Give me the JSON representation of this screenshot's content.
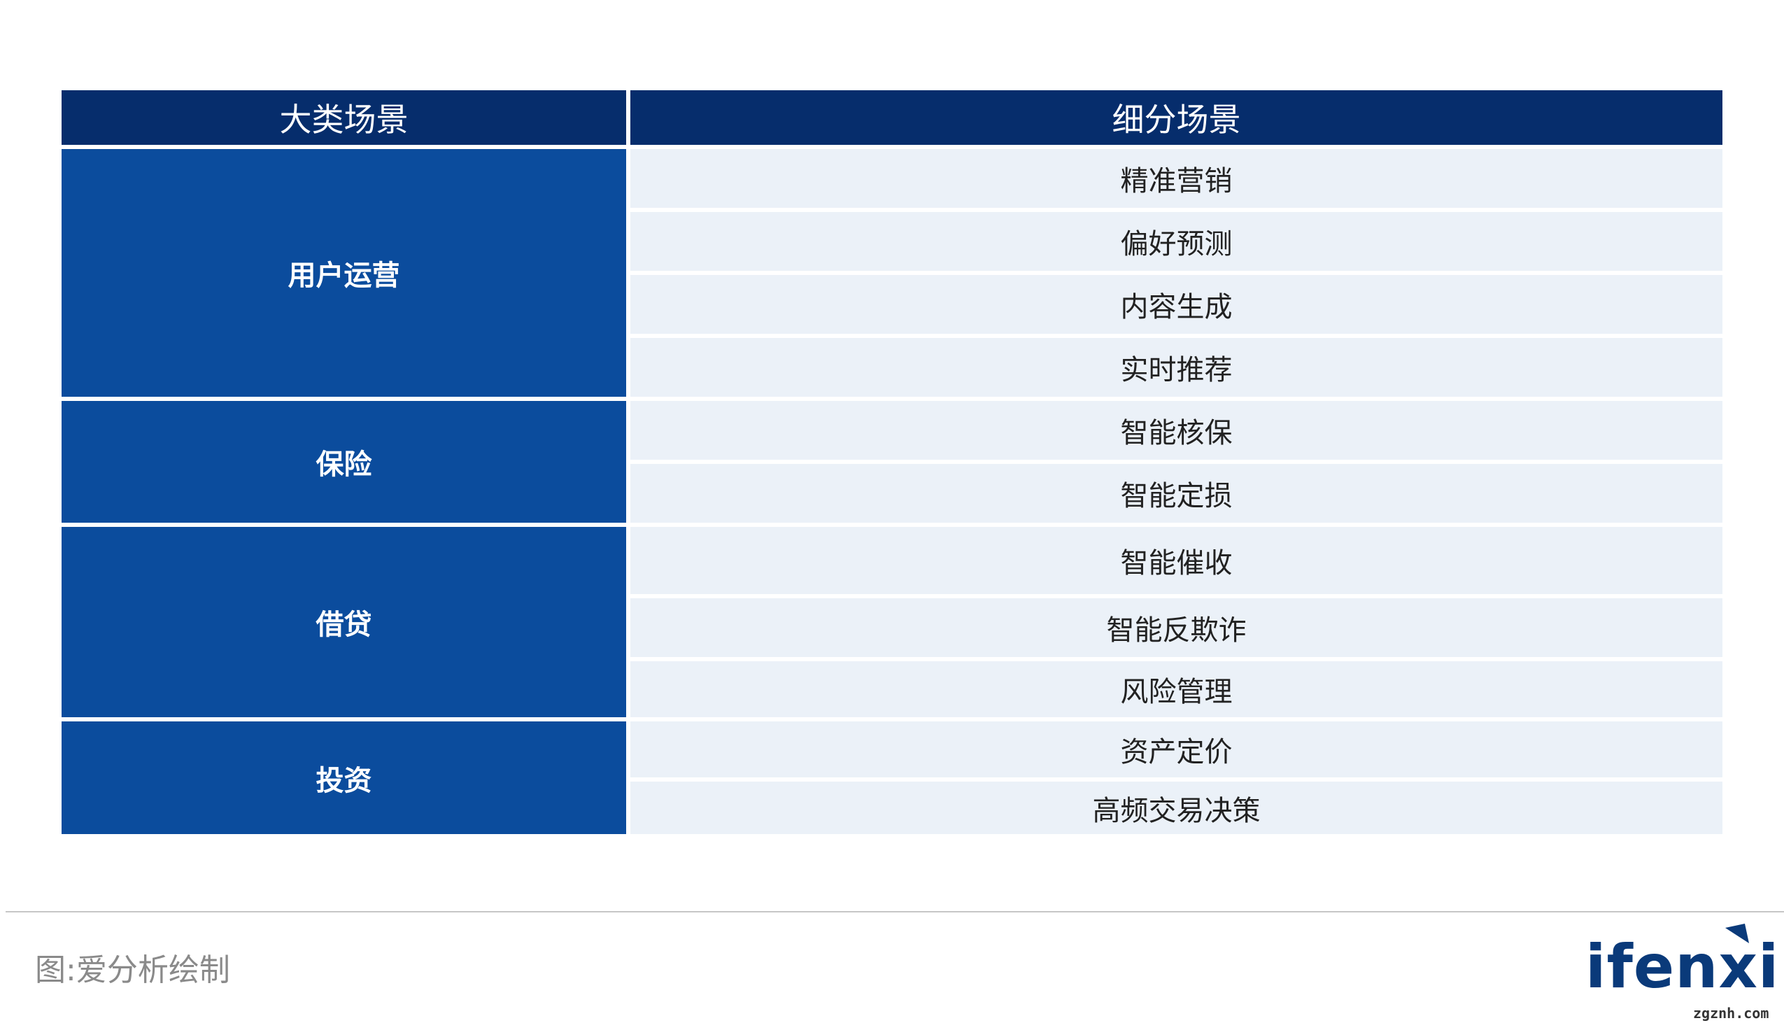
{
  "table": {
    "headers": [
      "大类场景",
      "细分场景"
    ],
    "groups": [
      {
        "category": "用户运营",
        "items": [
          "精准营销",
          "偏好预测",
          "内容生成",
          "实时推荐"
        ]
      },
      {
        "category": "保险",
        "items": [
          "智能核保",
          "智能定损"
        ]
      },
      {
        "category": "借贷",
        "items": [
          "智能催收",
          "智能反欺诈",
          "风险管理"
        ]
      },
      {
        "category": "投资",
        "items": [
          "资产定价",
          "高频交易决策"
        ]
      }
    ]
  },
  "footer": {
    "source": "图:爱分析绘制",
    "logo_text": "ifenxi",
    "watermark": "zgznh.com"
  },
  "colors": {
    "header_bg": "#062d6c",
    "category_bg": "#0b4c9d",
    "subcell_bg": "#ebf1f8",
    "logo": "#0a3a7a"
  }
}
